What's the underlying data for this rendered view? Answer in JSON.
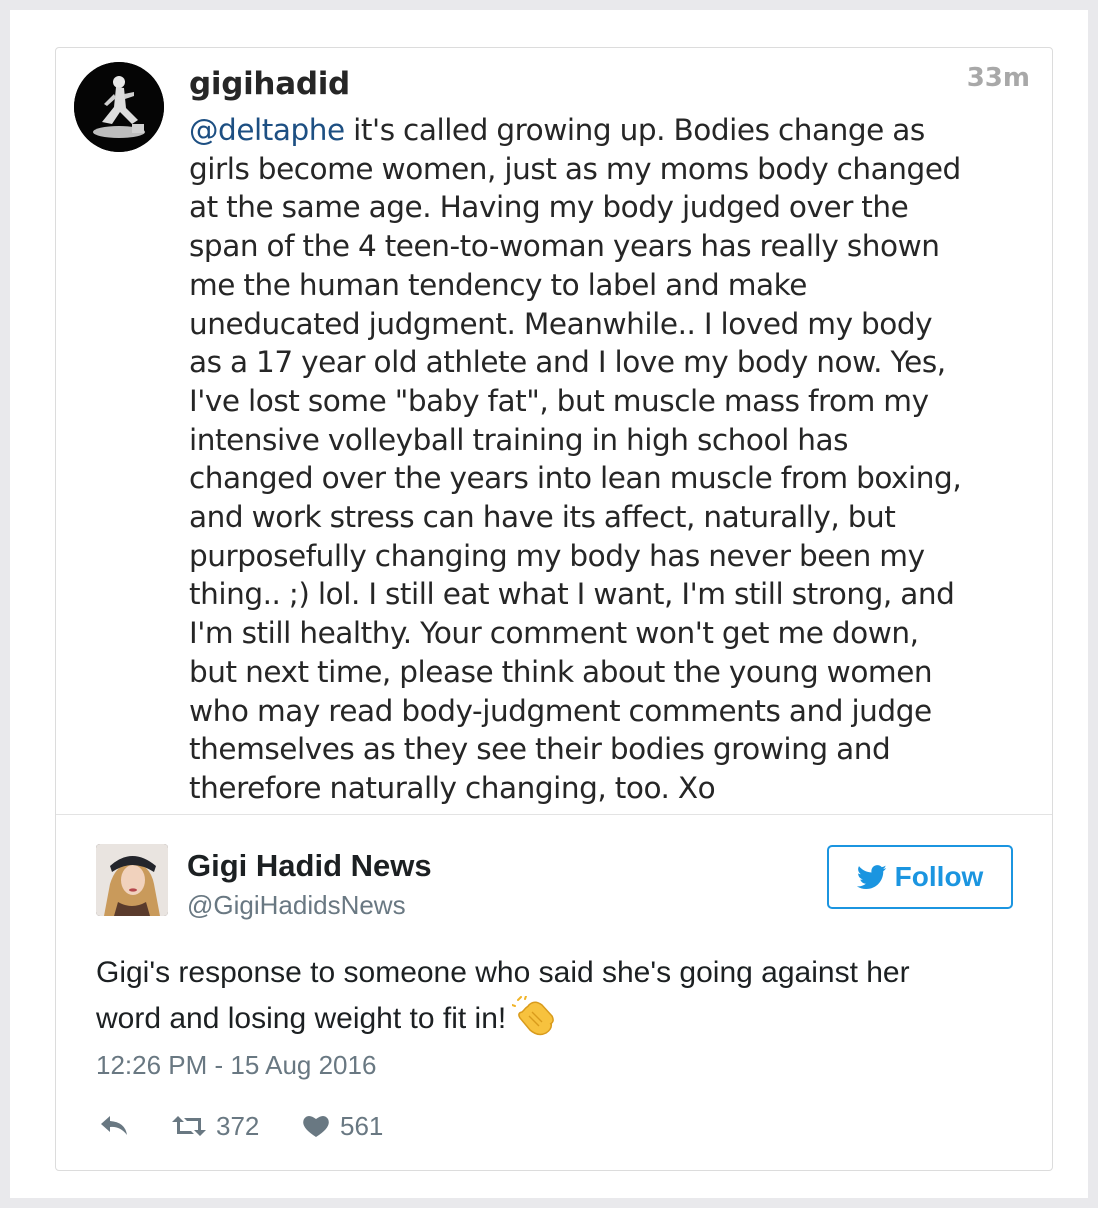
{
  "instagram": {
    "avatar_icon": "profile-photo",
    "username": "gigihadid",
    "time": "33m",
    "mention": "@deltaphe",
    "comment_lines": [
      " it's called growing up. Bodies change as",
      "girls become women, just as my moms body changed",
      "at the same age. Having my body judged over the",
      "span of the 4 teen-to-woman years has really shown",
      "me the human tendency to label and make",
      "uneducated judgment. Meanwhile.. I loved my body",
      "as a 17 year old athlete and I love my body now. Yes,",
      "I've lost some \"baby fat\", but muscle mass from my",
      "intensive volleyball training in high school has",
      "changed over the years into lean muscle from boxing,",
      "and work stress can have its affect, naturally, but",
      "purposefully changing my body has never been my",
      "thing.. ;) lol. I still eat what I want, I'm still strong, and",
      "I'm still healthy. Your comment won't get me down,",
      "but next time, please think about the young women",
      "who may read body-judgment comments and judge",
      "themselves as they see their bodies growing and",
      "therefore naturally changing, too. Xo"
    ]
  },
  "tweet": {
    "display_name": "Gigi Hadid News",
    "handle": "@GigiHadidsNews",
    "follow_label": "Follow",
    "text_lines": [
      "Gigi's response to someone who said she's going against her",
      "word and losing weight to fit in!"
    ],
    "emoji": "clapping-hands",
    "timestamp": "12:26 PM - 15 Aug 2016",
    "retweets": "372",
    "likes": "561"
  },
  "colors": {
    "twitter_blue": "#1b95e0",
    "mention_blue": "#1d4f82",
    "muted_gray": "#697882",
    "emoji_yellow": "#f7c23e"
  }
}
